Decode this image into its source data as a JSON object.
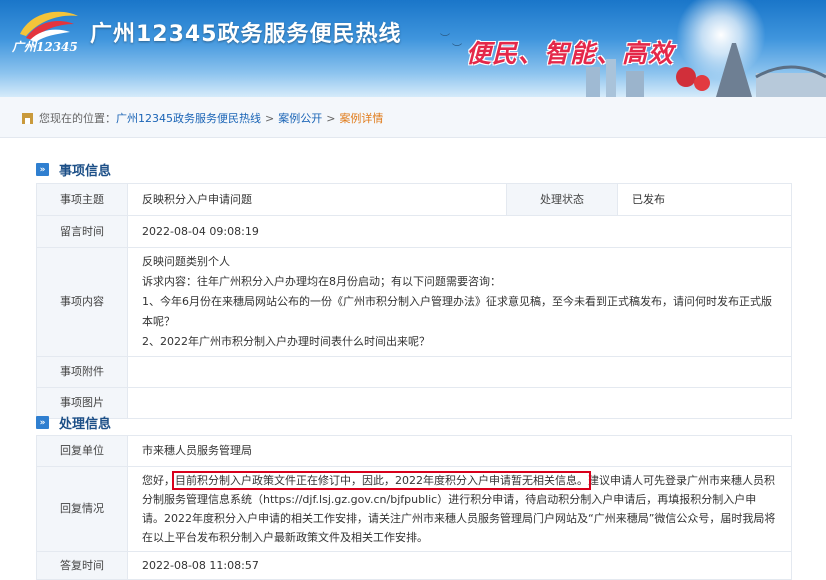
{
  "header": {
    "logo_text": "广州12345",
    "site_title": "广州12345政务服务便民热线",
    "slogan": "便民、智能、高效"
  },
  "breadcrumb": {
    "prefix": "您现在的位置：",
    "items": [
      "广州12345政务服务便民热线",
      "案例公开",
      "案例详情"
    ]
  },
  "matter": {
    "section_title": "事项信息",
    "subject_label": "事项主题",
    "subject": "反映积分入户申请问题",
    "status_label": "处理状态",
    "status": "已发布",
    "time_label": "留言时间",
    "time": "2022-08-04 09:08:19",
    "content_label": "事项内容",
    "content_lines": [
      "反映问题类别个人",
      "诉求内容：往年广州积分入户办理均在8月份启动；有以下问题需要咨询：",
      "1、今年6月份在来穗局网站公布的一份《广州市积分制入户管理办法》征求意见稿，至今未看到正式稿发布，请问何时发布正式版本呢？",
      "2、2022年广州市积分制入户办理时间表什么时间出来呢？"
    ],
    "attachment_label": "事项附件",
    "image_label": "事项图片"
  },
  "handling": {
    "section_title": "处理信息",
    "unit_label": "回复单位",
    "unit": "市来穗人员服务管理局",
    "reply_label": "回复情况",
    "reply_greeting": "您好，",
    "reply_highlight": "目前积分制入户政策文件正在修订中，因此，2022年度积分入户申请暂无相关信息。",
    "reply_rest": "建议申请人可先登录广州市来穗人员积分制服务管理信息系统（https://djf.lsj.gz.gov.cn/bjfpublic）进行积分申请，待启动积分制入户申请后，再填报积分制入户申请。2022年度积分入户申请的相关工作安排，请关注广州市来穗人员服务管理局门户网站及“广州来穗局”微信公众号，届时我局将在以上平台发布积分制入户最新政策文件及相关工作安排。",
    "reply_time_label": "答复时间",
    "reply_time": "2022-08-08 11:08:57"
  },
  "colors": {
    "accent": "#2f7fd0",
    "status_red": "#e0252a",
    "highlight_box": "#d8001b",
    "link_blue": "#1a64b6",
    "current_orange": "#e07b1a"
  }
}
